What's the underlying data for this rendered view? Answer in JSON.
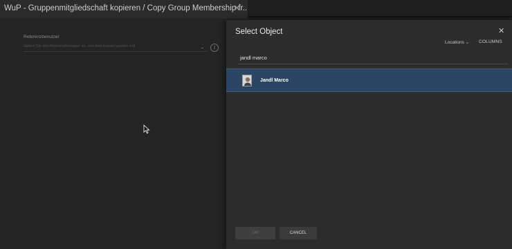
{
  "left_window": {
    "title": "WuP - Gruppenmitgliedschaft kopieren / Copy Group Membership fr...",
    "close_glyph": "✕",
    "field": {
      "label": "Referenzbenutzer",
      "placeholder": "Geben Sie den Referenzbenutzer an, von dem kopiert werden soll",
      "more_glyph": "...",
      "info_glyph": "i"
    }
  },
  "dialog": {
    "title": "Select Object",
    "close_glyph": "✕",
    "locations_label": "Locations",
    "locations_chevron": "⌄",
    "columns_label": "COLUMNS",
    "search": {
      "value": "jandl marco",
      "placeholder": ""
    },
    "results": [
      {
        "name": "Jandl Marco",
        "icon": "user-avatar-icon"
      }
    ],
    "ok_label": "OK",
    "cancel_label": "CANCEL"
  },
  "colors": {
    "selection": "#2b4563",
    "dialog_bg": "#2c2c2c",
    "left_bg": "#242424"
  }
}
